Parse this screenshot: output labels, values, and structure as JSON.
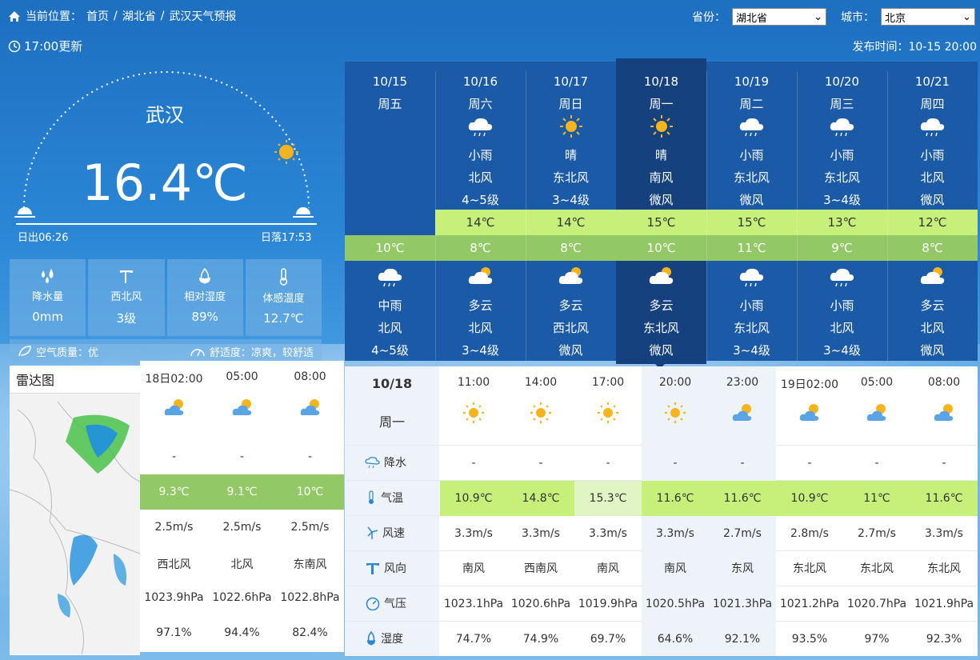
{
  "breadcrumb": {
    "label": "当前位置：",
    "home": "首页",
    "province": "湖北省",
    "page": "武汉天气预报",
    "sep": "/"
  },
  "selectors": {
    "province_label": "省份：",
    "province_value": "湖北省",
    "city_label": "城市：",
    "city_value": "北京"
  },
  "update_time": "17:00更新",
  "publish_time": "发布时间：10-15 20:00",
  "current": {
    "city": "武汉",
    "temp": "16.4℃",
    "sunrise": "日出06:26",
    "sunset": "日落17:53"
  },
  "stats": [
    {
      "label": "降水量",
      "value": "0mm",
      "icon": "raindrops-icon"
    },
    {
      "label": "西北风",
      "value": "3级",
      "icon": "wind-turbine-icon"
    },
    {
      "label": "相对湿度",
      "value": "89%",
      "icon": "water-drop-icon"
    },
    {
      "label": "体感温度",
      "value": "12.7℃",
      "icon": "thermometer-icon"
    }
  ],
  "air_quality": "空气质量：优",
  "comfort": "舒适度：凉爽，较舒适",
  "radar_title": "雷达图",
  "forecast": [
    {
      "date": "10/15",
      "dow": "周五",
      "day_weather": "",
      "day_wind": "",
      "day_level": "",
      "high": "",
      "low": "10℃",
      "night_weather": "中雨",
      "night_wind": "北风",
      "night_level": "4~5级",
      "day_icon": "",
      "night_icon": "rain-cloud-icon"
    },
    {
      "date": "10/16",
      "dow": "周六",
      "day_weather": "小雨",
      "day_wind": "北风",
      "day_level": "4~5级",
      "high": "14℃",
      "low": "8℃",
      "night_weather": "多云",
      "night_wind": "北风",
      "night_level": "3~4级",
      "day_icon": "rain-cloud-icon",
      "night_icon": "partly-cloudy-icon"
    },
    {
      "date": "10/17",
      "dow": "周日",
      "day_weather": "晴",
      "day_wind": "东北风",
      "day_level": "3~4级",
      "high": "14℃",
      "low": "8℃",
      "night_weather": "多云",
      "night_wind": "西北风",
      "night_level": "微风",
      "day_icon": "sun-icon",
      "night_icon": "partly-cloudy-icon"
    },
    {
      "date": "10/18",
      "dow": "周一",
      "day_weather": "晴",
      "day_wind": "南风",
      "day_level": "微风",
      "high": "15℃",
      "low": "10℃",
      "night_weather": "多云",
      "night_wind": "东北风",
      "night_level": "微风",
      "day_icon": "sun-icon",
      "night_icon": "partly-cloudy-icon"
    },
    {
      "date": "10/19",
      "dow": "周二",
      "day_weather": "小雨",
      "day_wind": "东北风",
      "day_level": "微风",
      "high": "15℃",
      "low": "11℃",
      "night_weather": "小雨",
      "night_wind": "东北风",
      "night_level": "3~4级",
      "day_icon": "rain-cloud-icon",
      "night_icon": "rain-cloud-icon"
    },
    {
      "date": "10/20",
      "dow": "周三",
      "day_weather": "小雨",
      "day_wind": "东北风",
      "day_level": "3~4级",
      "high": "13℃",
      "low": "9℃",
      "night_weather": "小雨",
      "night_wind": "北风",
      "night_level": "3~4级",
      "day_icon": "rain-cloud-icon",
      "night_icon": "rain-cloud-icon"
    },
    {
      "date": "10/21",
      "dow": "周四",
      "day_weather": "小雨",
      "day_wind": "北风",
      "day_level": "微风",
      "high": "12℃",
      "low": "8℃",
      "night_weather": "多云",
      "night_wind": "北风",
      "night_level": "微风",
      "day_icon": "rain-cloud-icon",
      "night_icon": "partly-cloudy-icon"
    }
  ],
  "left_hourly": [
    {
      "time": "18日02:00",
      "precip": "-",
      "temp": "9.3℃",
      "speed": "2.5m/s",
      "dir": "西北风",
      "pressure": "1023.9hPa",
      "humidity": "97.1%"
    },
    {
      "time": "05:00",
      "precip": "-",
      "temp": "9.1℃",
      "speed": "2.5m/s",
      "dir": "北风",
      "pressure": "1022.6hPa",
      "humidity": "94.4%"
    },
    {
      "time": "08:00",
      "precip": "-",
      "temp": "10℃",
      "speed": "2.5m/s",
      "dir": "东南风",
      "pressure": "1022.8hPa",
      "humidity": "82.4%"
    }
  ],
  "hourly": {
    "date": "10/18",
    "dow": "周一",
    "labels": {
      "precip": "降水",
      "temp": "气温",
      "speed": "风速",
      "dir": "风向",
      "pressure": "气压",
      "humidity": "湿度"
    },
    "cols": [
      {
        "time": "11:00",
        "icon": "sun-icon",
        "precip": "-",
        "temp": "10.9℃",
        "speed": "3.3m/s",
        "dir": "南风",
        "pressure": "1023.1hPa",
        "humidity": "74.7%"
      },
      {
        "time": "14:00",
        "icon": "sun-icon",
        "precip": "-",
        "temp": "14.8℃",
        "speed": "3.3m/s",
        "dir": "西南风",
        "pressure": "1020.6hPa",
        "humidity": "74.9%"
      },
      {
        "time": "17:00",
        "icon": "sun-icon",
        "precip": "-",
        "temp": "15.3℃",
        "speed": "3.3m/s",
        "dir": "南风",
        "pressure": "1019.9hPa",
        "humidity": "69.7%"
      },
      {
        "time": "20:00",
        "icon": "sun-icon",
        "precip": "-",
        "temp": "11.6℃",
        "speed": "3.3m/s",
        "dir": "南风",
        "pressure": "1020.5hPa",
        "humidity": "64.6%"
      },
      {
        "time": "23:00",
        "icon": "partly-cloudy-icon",
        "precip": "-",
        "temp": "11.6℃",
        "speed": "2.7m/s",
        "dir": "东风",
        "pressure": "1021.3hPa",
        "humidity": "92.1%"
      },
      {
        "time": "19日02:00",
        "icon": "partly-cloudy-icon",
        "precip": "-",
        "temp": "10.9℃",
        "speed": "2.8m/s",
        "dir": "东北风",
        "pressure": "1021.2hPa",
        "humidity": "93.5%"
      },
      {
        "time": "05:00",
        "icon": "partly-cloudy-icon",
        "precip": "-",
        "temp": "11℃",
        "speed": "2.7m/s",
        "dir": "东北风",
        "pressure": "1020.7hPa",
        "humidity": "97%"
      },
      {
        "time": "08:00",
        "icon": "partly-cloudy-icon",
        "precip": "-",
        "temp": "11.6℃",
        "speed": "3.3m/s",
        "dir": "东北风",
        "pressure": "1021.9hPa",
        "humidity": "92.3%"
      }
    ]
  },
  "colors": {
    "panel_dark": "#1b5aa6",
    "panel_selected": "#15427e",
    "high_band": "#c7f07b",
    "low_band": "#92c966",
    "sun": "#f5b41e"
  }
}
